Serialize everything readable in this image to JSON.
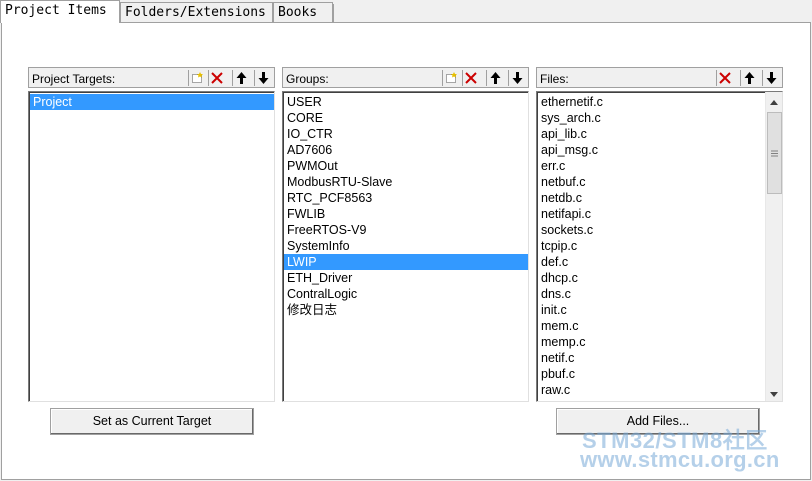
{
  "tabs": [
    {
      "label": "Project Items",
      "active": true
    },
    {
      "label": "Folders/Extensions",
      "active": false
    },
    {
      "label": "Books",
      "active": false
    }
  ],
  "targets": {
    "title": "Project Targets:",
    "items": [
      "Project"
    ],
    "selected_index": 0
  },
  "groups": {
    "title": "Groups:",
    "items": [
      "USER",
      "CORE",
      "IO_CTR",
      "AD7606",
      "PWMOut",
      "ModbusRTU-Slave",
      "RTC_PCF8563",
      "FWLIB",
      "FreeRTOS-V9",
      "SystemInfo",
      "LWIP",
      "ETH_Driver",
      "ContralLogic",
      "修改日志"
    ],
    "selected_index": 10
  },
  "files": {
    "title": "Files:",
    "items": [
      "ethernetif.c",
      "sys_arch.c",
      "api_lib.c",
      "api_msg.c",
      "err.c",
      "netbuf.c",
      "netdb.c",
      "netifapi.c",
      "sockets.c",
      "tcpip.c",
      "def.c",
      "dhcp.c",
      "dns.c",
      "init.c",
      "mem.c",
      "memp.c",
      "netif.c",
      "pbuf.c",
      "raw.c"
    ]
  },
  "buttons": {
    "set_target": "Set as Current Target",
    "add_files": "Add Files..."
  },
  "watermark": {
    "line1": "STM32/STM8社区",
    "line2": "www.stmcu.org.cn"
  },
  "colors": {
    "selection": "#3399ff",
    "delete_red": "#cc0000"
  }
}
